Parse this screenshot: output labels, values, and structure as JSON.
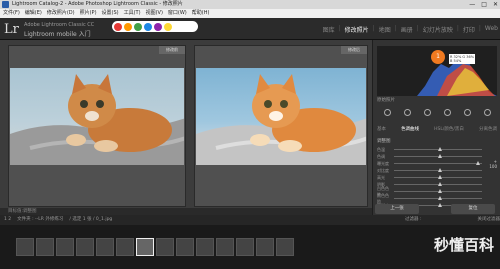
{
  "window": {
    "title": "Lightroom Catalog-2 - Adobe Photoshop Lightroom Classic - 修改照片",
    "controls": [
      "—",
      "□",
      "✕"
    ]
  },
  "menu": [
    "文件(F)",
    "编辑(E)",
    "修改照片(D)",
    "照片(P)",
    "设置(S)",
    "工具(T)",
    "视图(V)",
    "窗口(W)",
    "帮助(H)"
  ],
  "identity": {
    "logo": "Lr",
    "catalog": "Adobe Lightroom Classic CC",
    "mobile": "Lightroom mobile 入门"
  },
  "modules": {
    "items": [
      "图库",
      "修改照片",
      "地图",
      "画册",
      "幻灯片放映",
      "打印",
      "Web"
    ],
    "active": "修改照片"
  },
  "view": {
    "before_label": "修改前",
    "after_label": "修改后"
  },
  "toolbar": {
    "label": "目标值:调整图"
  },
  "histogram": {
    "badge": "1",
    "rgb_line1": "R 32%   G 36%",
    "rgb_line2": "B 54%",
    "original_label": "原始照片"
  },
  "right_tabs": [
    "基本",
    "色调曲线",
    "HSL/颜色/黑白",
    "分离色调"
  ],
  "right_tabs_active": "色调曲线",
  "panel_title": "调整图",
  "sliders": [
    {
      "label": "色温",
      "value": "",
      "pos": 0.5
    },
    {
      "label": "色调",
      "value": "",
      "pos": 0.5
    },
    {
      "label": "曝光度",
      "value": "+ 100",
      "pos": 0.93
    },
    {
      "label": "对比度",
      "value": "",
      "pos": 0.5
    },
    {
      "label": "高光",
      "value": "",
      "pos": 0.5
    },
    {
      "label": "阴影",
      "value": "",
      "pos": 0.5
    },
    {
      "label": "白色色阶",
      "value": "",
      "pos": 0.5
    },
    {
      "label": "黑色色阶",
      "value": "",
      "pos": 0.5
    },
    {
      "label": "清晰度",
      "value": "",
      "pos": 0.5
    }
  ],
  "buttons": {
    "previous": "上一张",
    "reset": "复位"
  },
  "filmbar": {
    "pages": "1  2",
    "folder": "文件夹 : --LR 外修练习",
    "selection": "/ 选定 1 张 / 0_1.jpg",
    "filter": "过滤器 :",
    "filter_off": "关闭过滤器"
  },
  "watermark": "秒懂百科"
}
